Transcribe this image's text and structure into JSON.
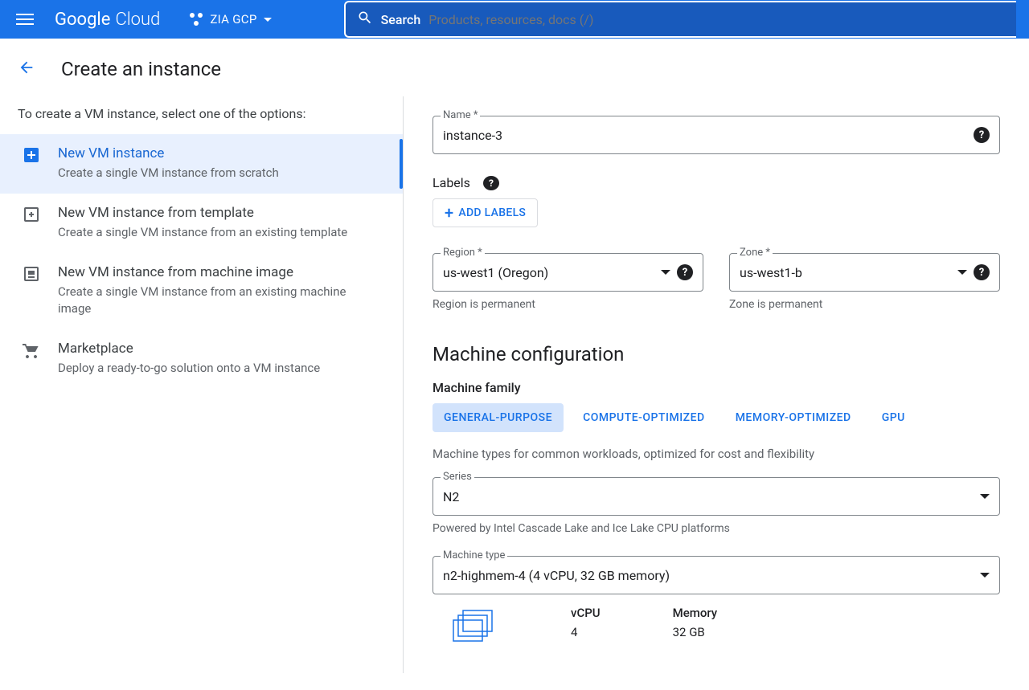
{
  "header": {
    "logo_a": "Google",
    "logo_b": "Cloud",
    "project": "ZIA GCP",
    "search_label": "Search",
    "search_placeholder": "Products, resources, docs (/)"
  },
  "page": {
    "title": "Create an instance"
  },
  "sidebar": {
    "hint": "To create a VM instance, select one of the options:",
    "options": [
      {
        "title": "New VM instance",
        "sub": "Create a single VM instance from scratch"
      },
      {
        "title": "New VM instance from template",
        "sub": "Create a single VM instance from an existing template"
      },
      {
        "title": "New VM instance from machine image",
        "sub": "Create a single VM instance from an existing machine image"
      },
      {
        "title": "Marketplace",
        "sub": "Deploy a ready-to-go solution onto a VM instance"
      }
    ]
  },
  "form": {
    "name_label": "Name *",
    "name_value": "instance-3",
    "labels_label": "Labels",
    "add_labels": "ADD LABELS",
    "region_label": "Region *",
    "region_value": "us-west1 (Oregon)",
    "region_hint": "Region is permanent",
    "zone_label": "Zone *",
    "zone_value": "us-west1-b",
    "zone_hint": "Zone is permanent"
  },
  "machine": {
    "heading": "Machine configuration",
    "family_label": "Machine family",
    "tabs": [
      "GENERAL-PURPOSE",
      "COMPUTE-OPTIMIZED",
      "MEMORY-OPTIMIZED",
      "GPU"
    ],
    "tab_desc": "Machine types for common workloads, optimized for cost and flexibility",
    "series_label": "Series",
    "series_value": "N2",
    "series_hint": "Powered by Intel Cascade Lake and Ice Lake CPU platforms",
    "type_label": "Machine type",
    "type_value": "n2-highmem-4 (4 vCPU, 32 GB memory)",
    "vcpu_label": "vCPU",
    "vcpu_value": "4",
    "mem_label": "Memory",
    "mem_value": "32 GB"
  }
}
